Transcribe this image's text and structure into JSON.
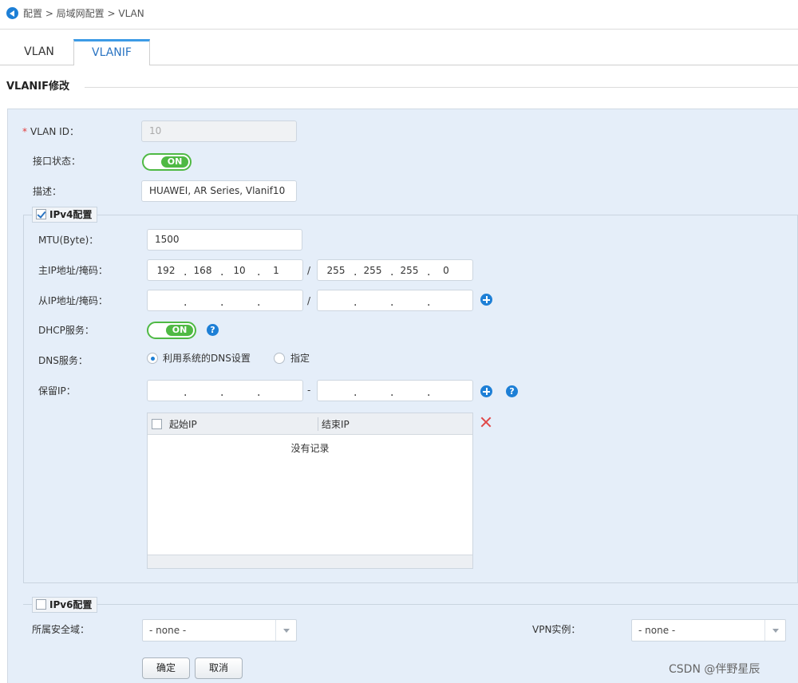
{
  "breadcrumb": {
    "text": "配置 > 局域网配置 > VLAN"
  },
  "tabs": [
    {
      "label": "VLAN",
      "active": false
    },
    {
      "label": "VLANIF",
      "active": true
    }
  ],
  "section_title": "VLANIF修改",
  "form": {
    "vlan_id": {
      "label": "VLAN ID：",
      "value": "10",
      "required_mark": "*"
    },
    "interface_status": {
      "label": "接口状态：",
      "toggle": "ON"
    },
    "description": {
      "label": "描述：",
      "value": "HUAWEI, AR Series, Vlanif10"
    }
  },
  "ipv4": {
    "legend": "IPv4配置",
    "checked": true,
    "mtu": {
      "label": "MTU(Byte)：",
      "value": "1500"
    },
    "primary_ip": {
      "label": "主IP地址/掩码：",
      "ip": [
        "192",
        "168",
        "10",
        "1"
      ],
      "mask": [
        "255",
        "255",
        "255",
        "0"
      ],
      "separator": "/"
    },
    "secondary_ip": {
      "label": "从IP地址/掩码：",
      "separator": "/"
    },
    "dhcp": {
      "label": "DHCP服务：",
      "toggle": "ON"
    },
    "dns": {
      "label": "DNS服务：",
      "options": [
        "利用系统的DNS设置",
        "指定"
      ],
      "selected": "利用系统的DNS设置"
    },
    "reserved_ip": {
      "label": "保留IP：",
      "separator": "-",
      "table": {
        "columns": [
          "起始IP",
          "结束IP"
        ],
        "empty_text": "没有记录"
      }
    }
  },
  "ipv6": {
    "legend": "IPv6配置",
    "checked": false
  },
  "security_zone": {
    "label": "所属安全域：",
    "value": "- none -"
  },
  "vpn_instance": {
    "label": "VPN实例：",
    "value": "- none -"
  },
  "buttons": {
    "ok": "确定",
    "cancel": "取消"
  },
  "watermark": "CSDN @伴野星辰",
  "icons": {
    "back": "back-arrow-icon",
    "add": "plus-circle-icon",
    "help": "help-icon",
    "delete": "close-icon"
  },
  "colors": {
    "accent": "#1d7fd6",
    "toggle_on": "#4fb944",
    "panel_bg": "#e5eef9",
    "delete": "#e04848"
  }
}
